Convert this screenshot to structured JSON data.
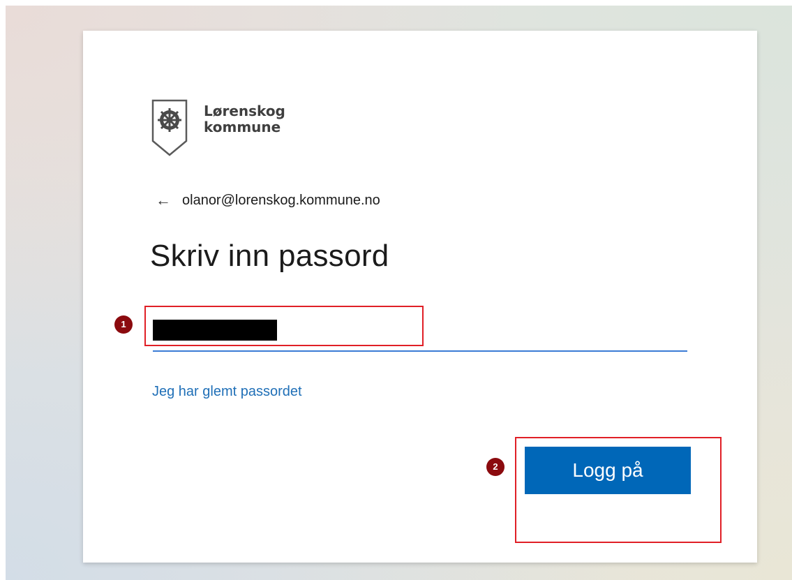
{
  "brand": {
    "name": "Lørenskog\nkommune",
    "logo_icon": "municipal-shield-wheel-icon",
    "accent_color": "#0067b8"
  },
  "identity": {
    "back_icon": "arrow-left-icon",
    "email": "olanor@lorenskog.kommune.no"
  },
  "main": {
    "title": "Skriv inn passord",
    "forgot_link": "Jeg har glemt passordet",
    "signin_button": "Logg på"
  },
  "annotations": {
    "marker_1": "1",
    "marker_2": "2",
    "color": "#e01f26"
  }
}
